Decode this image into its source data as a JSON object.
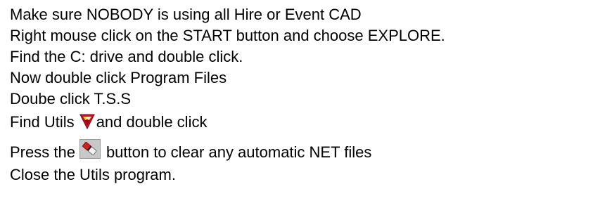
{
  "instructions": {
    "step1": "Make sure NOBODY is using all Hire or Event CAD",
    "step2": "Right mouse click on the START button and choose EXPLORE.",
    "step3": "Find the C: drive and double click.",
    "step4": "Now double click Program Files",
    "step5": "Doube click T.S.S",
    "step6_before": "Find Utils",
    "step6_after": "and double click",
    "step7_before": "Press the",
    "step7_after": "button to clear any automatic NET files",
    "step8": "Close the Utils program."
  },
  "icons": {
    "utils": "utils-program-icon",
    "clear": "clear-net-files-icon"
  },
  "colors": {
    "text": "#000000",
    "background": "#ffffff"
  }
}
